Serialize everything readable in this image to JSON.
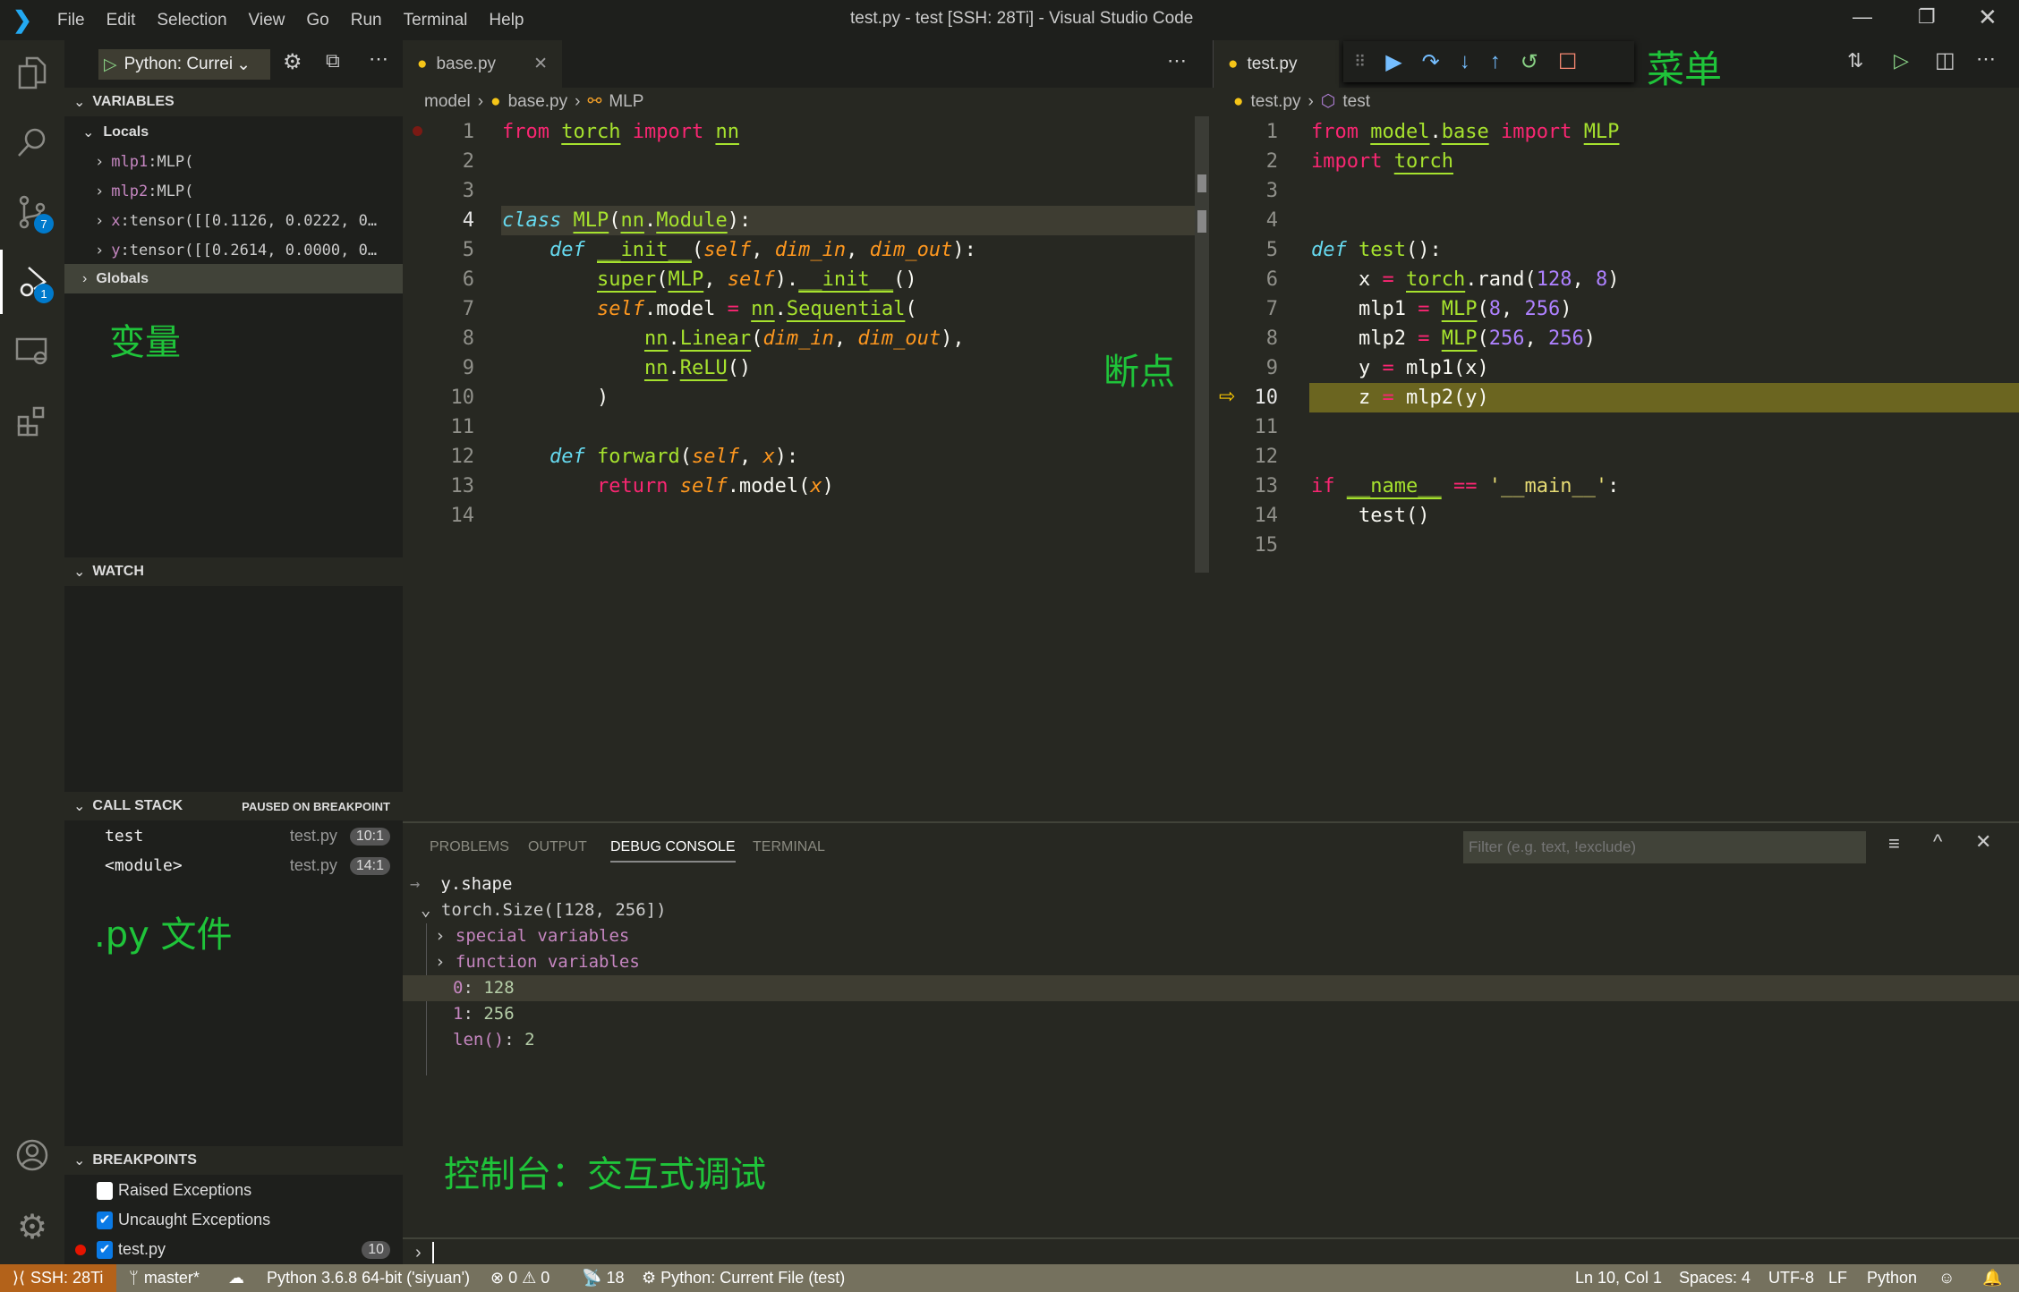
{
  "window": {
    "title": "test.py - test [SSH: 28Ti] - Visual Studio Code",
    "menu": [
      "File",
      "Edit",
      "Selection",
      "View",
      "Go",
      "Run",
      "Terminal",
      "Help"
    ]
  },
  "activity": {
    "scm_badge": "7",
    "debug_badge": "1"
  },
  "debug": {
    "config": "Python: Currei"
  },
  "sidebar": {
    "variables_title": "VARIABLES",
    "locals": "Locals",
    "vars": [
      {
        "name": "mlp1",
        "value": "MLP("
      },
      {
        "name": "mlp2",
        "value": "MLP("
      },
      {
        "name": "x",
        "value": "tensor([[0.1126, 0.0222, 0…"
      },
      {
        "name": "y",
        "value": "tensor([[0.2614, 0.0000, 0…"
      }
    ],
    "globals": "Globals",
    "watch_title": "WATCH",
    "callstack_title": "CALL STACK",
    "callstack_status": "PAUSED ON BREAKPOINT",
    "frames": [
      {
        "name": "test",
        "file": "test.py",
        "pos": "10:1"
      },
      {
        "name": "<module>",
        "file": "test.py",
        "pos": "14:1"
      }
    ],
    "breakpoints_title": "BREAKPOINTS",
    "breakpoints": [
      {
        "label": "Raised Exceptions",
        "checked": false
      },
      {
        "label": "Uncaught Exceptions",
        "checked": true
      },
      {
        "label": "test.py",
        "checked": true,
        "line": "10"
      }
    ]
  },
  "annotations": {
    "variables": "变量",
    "files": ".py 文件",
    "breakpoint": "断点",
    "menu": "菜单",
    "console": "控制台：交互式调试"
  },
  "left_editor": {
    "tab": "base.py",
    "crumbs": [
      "model",
      "base.py",
      "MLP"
    ],
    "lines": [
      [
        [
          "from",
          "kw"
        ],
        [
          " "
        ],
        [
          "torch",
          "cls u"
        ],
        [
          " "
        ],
        [
          "import",
          "kw"
        ],
        [
          " "
        ],
        [
          "nn",
          "cls u"
        ]
      ],
      [],
      [],
      [
        [
          "class",
          "sto"
        ],
        [
          " "
        ],
        [
          "MLP",
          "cls u"
        ],
        [
          "("
        ],
        [
          "nn",
          "cls u"
        ],
        [
          "."
        ],
        [
          "Module",
          "cls u"
        ],
        [
          "):"
        ]
      ],
      [
        [
          "    "
        ],
        [
          "def",
          "sto"
        ],
        [
          " "
        ],
        [
          "__init__",
          "fn u"
        ],
        [
          "("
        ],
        [
          "self",
          "par"
        ],
        [
          ", "
        ],
        [
          "dim_in",
          "par"
        ],
        [
          ", "
        ],
        [
          "dim_out",
          "par"
        ],
        [
          "):"
        ]
      ],
      [
        [
          "        "
        ],
        [
          "super",
          "fn u"
        ],
        [
          "("
        ],
        [
          "MLP",
          "cls u"
        ],
        [
          ", "
        ],
        [
          "self",
          "par"
        ],
        [
          ")."
        ],
        [
          "__init__",
          "fn u"
        ],
        [
          "()"
        ]
      ],
      [
        [
          "        "
        ],
        [
          "self",
          "par"
        ],
        [
          ".model "
        ],
        [
          "=",
          "kw"
        ],
        [
          " "
        ],
        [
          "nn",
          "cls u"
        ],
        [
          "."
        ],
        [
          "Sequential",
          "cls u"
        ],
        [
          "("
        ]
      ],
      [
        [
          "            "
        ],
        [
          "nn",
          "cls u"
        ],
        [
          "."
        ],
        [
          "Linear",
          "cls u"
        ],
        [
          "("
        ],
        [
          "dim_in",
          "par"
        ],
        [
          ", "
        ],
        [
          "dim_out",
          "par"
        ],
        [
          "),"
        ]
      ],
      [
        [
          "            "
        ],
        [
          "nn",
          "cls u"
        ],
        [
          "."
        ],
        [
          "ReLU",
          "cls u"
        ],
        [
          "()"
        ]
      ],
      [
        [
          "        )"
        ]
      ],
      [],
      [
        [
          "    "
        ],
        [
          "def",
          "sto"
        ],
        [
          " "
        ],
        [
          "forward",
          "fn"
        ],
        [
          "("
        ],
        [
          "self",
          "par"
        ],
        [
          ", "
        ],
        [
          "x",
          "par"
        ],
        [
          "):"
        ]
      ],
      [
        [
          "        "
        ],
        [
          "return",
          "kw"
        ],
        [
          " "
        ],
        [
          "self",
          "par"
        ],
        [
          ".model("
        ],
        [
          "x",
          "par"
        ],
        [
          ")"
        ]
      ],
      []
    ]
  },
  "right_editor": {
    "tab": "test.py",
    "crumbs": [
      "test.py",
      "test"
    ],
    "lines": [
      [
        [
          "from",
          "kw"
        ],
        [
          " "
        ],
        [
          "model",
          "cls u"
        ],
        [
          "."
        ],
        [
          "base",
          "cls u"
        ],
        [
          " "
        ],
        [
          "import",
          "kw"
        ],
        [
          " "
        ],
        [
          "MLP",
          "cls u"
        ]
      ],
      [
        [
          "import",
          "kw"
        ],
        [
          " "
        ],
        [
          "torch",
          "cls u"
        ]
      ],
      [],
      [],
      [
        [
          "def",
          "sto"
        ],
        [
          " "
        ],
        [
          "test",
          "fn"
        ],
        [
          "():"
        ]
      ],
      [
        [
          "    x "
        ],
        [
          "=",
          "kw"
        ],
        [
          " "
        ],
        [
          "torch",
          "cls u"
        ],
        [
          ".rand("
        ],
        [
          "128",
          "num"
        ],
        [
          ", "
        ],
        [
          "8",
          "num"
        ],
        [
          ")"
        ]
      ],
      [
        [
          "    mlp1 "
        ],
        [
          "=",
          "kw"
        ],
        [
          " "
        ],
        [
          "MLP",
          "cls u"
        ],
        [
          "("
        ],
        [
          "8",
          "num"
        ],
        [
          ", "
        ],
        [
          "256",
          "num"
        ],
        [
          ")"
        ]
      ],
      [
        [
          "    mlp2 "
        ],
        [
          "=",
          "kw"
        ],
        [
          " "
        ],
        [
          "MLP",
          "cls u"
        ],
        [
          "("
        ],
        [
          "256",
          "num"
        ],
        [
          ", "
        ],
        [
          "256",
          "num"
        ],
        [
          ")"
        ]
      ],
      [
        [
          "    y "
        ],
        [
          "=",
          "kw"
        ],
        [
          " mlp1(x)"
        ]
      ],
      [
        [
          "    z "
        ],
        [
          "=",
          "kw"
        ],
        [
          " mlp2(y)"
        ]
      ],
      [],
      [],
      [
        [
          "if",
          "kw"
        ],
        [
          " "
        ],
        [
          "__name__",
          "cls u"
        ],
        [
          " "
        ],
        [
          "==",
          "kw"
        ],
        [
          " "
        ],
        [
          "'__main__'",
          "str"
        ],
        [
          ":"
        ]
      ],
      [
        [
          "    test()"
        ]
      ],
      []
    ]
  },
  "panel": {
    "tabs": [
      "PROBLEMS",
      "OUTPUT",
      "DEBUG CONSOLE",
      "TERMINAL"
    ],
    "active_tab": "DEBUG CONSOLE",
    "filter_placeholder": "Filter (e.g. text, !exclude)",
    "input": "y.shape",
    "result": "torch.Size([128, 256])",
    "special": "special variables",
    "function": "function variables",
    "items": [
      {
        "k": "0",
        "v": "128"
      },
      {
        "k": "1",
        "v": "256"
      },
      {
        "k": "len()",
        "v": "2"
      }
    ]
  },
  "status": {
    "remote": "SSH: 28Ti",
    "branch": "master*",
    "interpreter": "Python 3.6.8 64-bit ('siyuan')",
    "errors": "0",
    "warnings": "0",
    "ports": "18",
    "launch": "Python: Current File (test)",
    "position": "Ln 10, Col 1",
    "spaces": "Spaces: 4",
    "encoding": "UTF-8",
    "eol": "LF",
    "language": "Python"
  }
}
